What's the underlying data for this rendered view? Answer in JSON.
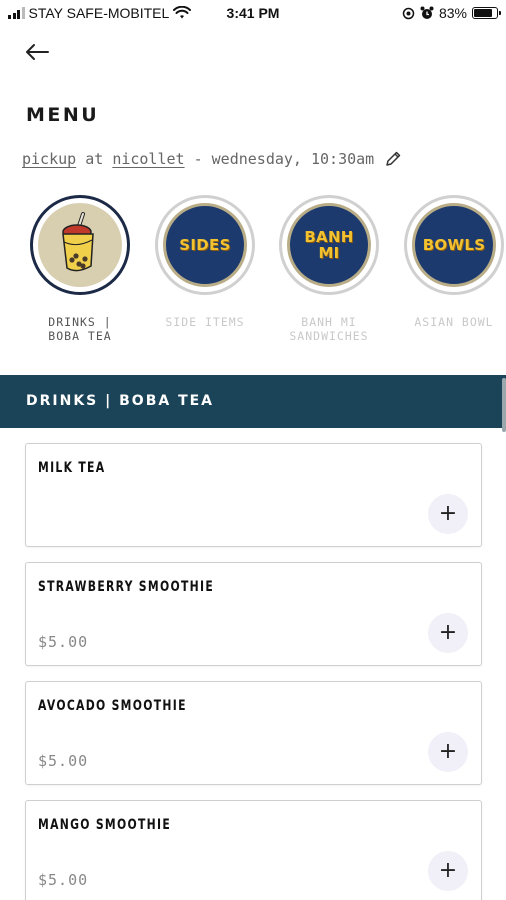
{
  "status_bar": {
    "carrier": "STAY SAFE-MOBITEL",
    "time": "3:41 PM",
    "battery": "83%",
    "battery_level": 0.83,
    "icons": [
      "signal-icon",
      "wifi-icon",
      "location-icon",
      "alarm-icon",
      "battery-icon"
    ]
  },
  "header": {
    "back_icon": "arrow-left-icon",
    "title": "MENU"
  },
  "pickup": {
    "mode": "pickup",
    "at": "at",
    "location": "nicollet",
    "separator": "-",
    "when": "wednesday, 10:30am",
    "edit_icon": "pencil-icon"
  },
  "categories": [
    {
      "label": "DRINKS |\nBOBA TEA",
      "badge": "",
      "active": true,
      "icon": "boba-tea-icon"
    },
    {
      "label": "SIDE ITEMS",
      "badge": "SIDES",
      "active": false
    },
    {
      "label": "BANH MI\nSANDWICHES",
      "badge": "BANH\nMI",
      "active": false
    },
    {
      "label": "ASIAN BOWL",
      "badge": "BOWLS",
      "active": false
    }
  ],
  "section": {
    "title": "DRINKS | BOBA TEA"
  },
  "items": [
    {
      "name": "MILK TEA",
      "price": ""
    },
    {
      "name": "STRAWBERRY SMOOTHIE",
      "price": "$5.00"
    },
    {
      "name": "AVOCADO SMOOTHIE",
      "price": "$5.00"
    },
    {
      "name": "MANGO SMOOTHIE",
      "price": "$5.00"
    }
  ],
  "add_label": "+",
  "colors": {
    "section_bg": "#1b4458",
    "category_navy": "#1c3a6e",
    "category_gold": "#f2c230",
    "add_button_bg": "#f1eff7"
  }
}
